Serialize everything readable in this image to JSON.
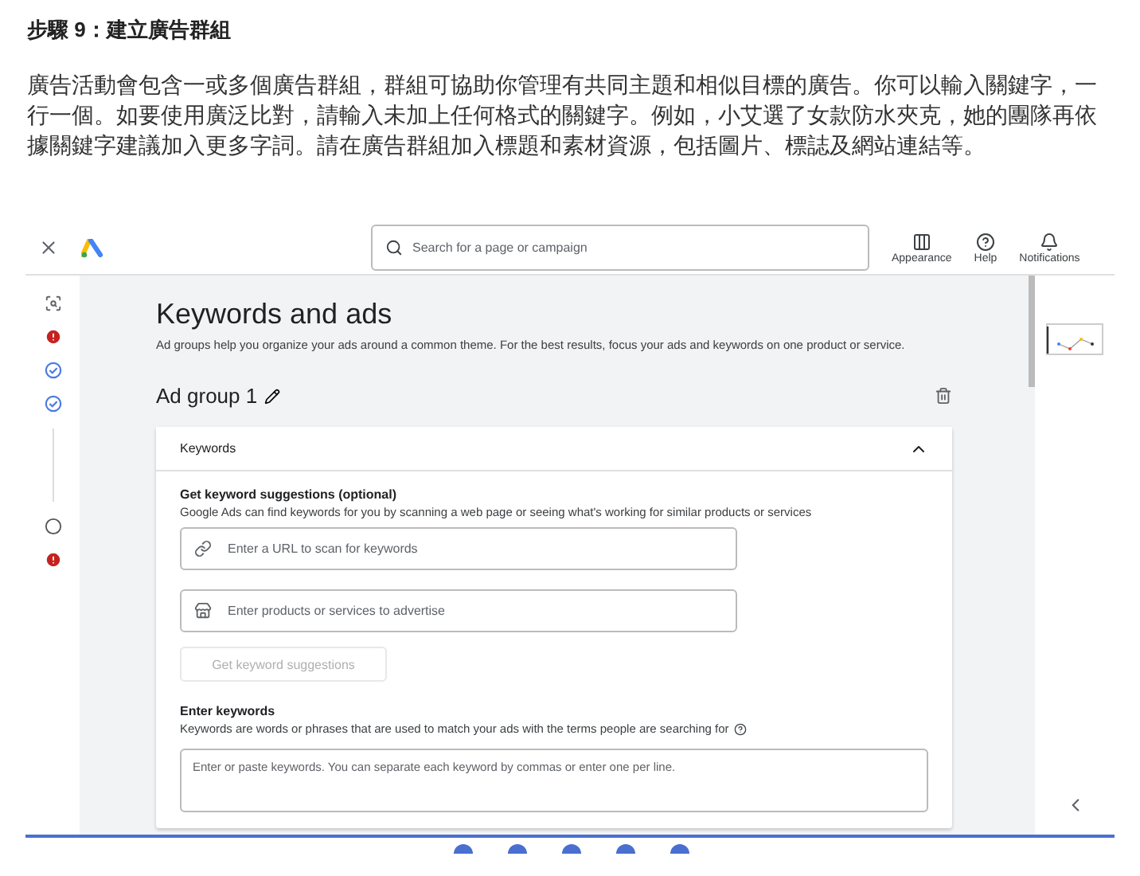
{
  "heading": "步驟 9：建立廣告群組",
  "paragraph": "廣告活動會包含一或多個廣告群組，群組可協助你管理有共同主題和相似目標的廣告。你可以輸入關鍵字，一行一個。如要使用廣泛比對，請輸入未加上任何格式的關鍵字。例如，小艾選了女款防水夾克，她的團隊再依據關鍵字建議加入更多字詞。請在廣告群組加入標題和素材資源，包括圖片、標誌及網站連結等。",
  "topbar": {
    "search": {
      "placeholder": "Search for a page or campaign"
    },
    "actions": [
      {
        "kind": "appearance",
        "label": "Appearance"
      },
      {
        "kind": "help",
        "label": "Help"
      },
      {
        "kind": "notifications",
        "label": "Notifications"
      }
    ]
  },
  "steps": [
    {
      "kind": "preview"
    },
    {
      "kind": "error"
    },
    {
      "kind": "done"
    },
    {
      "kind": "done"
    },
    {
      "kind": "line"
    },
    {
      "kind": "pending"
    },
    {
      "kind": "error"
    }
  ],
  "page": {
    "title": "Keywords and ads",
    "description": "Ad groups help you organize your ads around a common theme. For the best results, focus your ads and keywords on one product or service.",
    "ad_group": "Ad group 1"
  },
  "card": {
    "title": "Keywords",
    "expanded": true,
    "suggest_title": "Get keyword suggestions (optional)",
    "suggest_text": "Google Ads can find keywords for you by scanning a web page or seeing what's working for similar products or services",
    "fields": [
      {
        "kind": "url",
        "placeholder": "Enter a URL to scan for keywords"
      },
      {
        "kind": "products",
        "placeholder": "Enter products or services to advertise"
      }
    ],
    "suggest_button": {
      "label": "Get keyword suggestions",
      "disabled": true
    },
    "enter_title": "Enter keywords",
    "enter_text": "Keywords are words or phrases that are used to match your ads with the terms people are searching for",
    "keywords_placeholder": "Enter or paste keywords. You can separate each keyword by commas or enter one per line."
  }
}
